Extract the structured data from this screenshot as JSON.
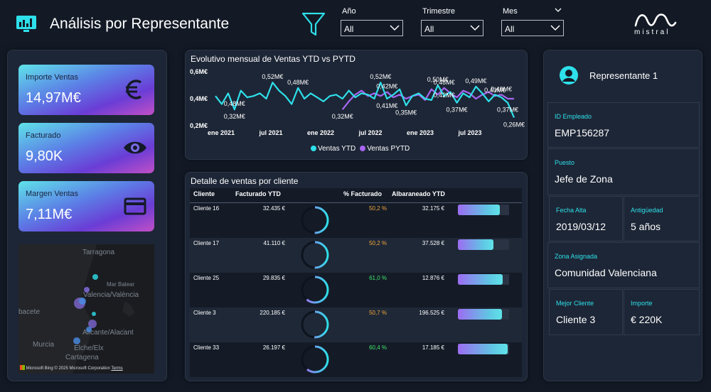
{
  "header": {
    "title": "Análisis por Representante",
    "brand": "mistral",
    "filters": [
      {
        "label": "Año",
        "value": "All"
      },
      {
        "label": "Trimestre",
        "value": "All"
      },
      {
        "label": "Mes",
        "value": "All"
      }
    ]
  },
  "kpis": [
    {
      "label": "Importe Ventas",
      "value": "14,97M€",
      "icon": "euro-icon"
    },
    {
      "label": "Facturado",
      "value": "9,80K",
      "icon": "eye-icon"
    },
    {
      "label": "Margen Ventas",
      "value": "7,11M€",
      "icon": "credit-card-icon"
    }
  ],
  "map": {
    "places": [
      "Tarragona",
      "Mar Balear",
      "Valencia/València",
      "bacete",
      "Alicante/Alacant",
      "Murcia",
      "Elche/Elx",
      "Cartagena"
    ],
    "copyright": "© 2025 Microsoft Corporation",
    "provider": "Microsoft Bing",
    "terms": "Terms"
  },
  "line_chart_title": "Evolutivo mensual de Ventas YTD vs PYTD",
  "chart_data": {
    "type": "line",
    "title": "Evolutivo mensual de Ventas YTD vs PYTD",
    "x_ticks": [
      "ene 2021",
      "jul 2021",
      "ene 2022",
      "jul 2022",
      "ene 2023",
      "jul 2023"
    ],
    "y_ticks": [
      "0,6M€",
      "0,4M€",
      "0,2M€"
    ],
    "ylim": [
      0.2,
      0.6
    ],
    "series": [
      {
        "name": "Ventas YTD",
        "color": "#2ee0ea",
        "values": [
          0.42,
          0.36,
          0.44,
          0.32,
          0.46,
          0.41,
          0.42,
          0.44,
          0.4,
          0.52,
          0.46,
          0.42,
          0.36,
          0.48,
          0.4,
          0.44,
          0.41,
          0.38,
          0.42,
          0.43,
          0.4,
          0.46,
          0.41,
          0.44,
          0.43,
          0.4,
          0.52,
          0.4,
          0.43,
          0.47,
          0.35,
          0.42,
          0.44,
          0.4,
          0.39,
          0.5,
          0.42,
          0.45,
          0.37,
          0.44,
          0.41,
          0.49,
          0.44,
          0.38,
          0.43,
          0.41,
          0.37,
          0.26
        ]
      },
      {
        "name": "Ventas PYTD",
        "color": "#a866f2",
        "values": [
          null,
          null,
          null,
          null,
          null,
          null,
          null,
          null,
          null,
          null,
          null,
          null,
          null,
          null,
          null,
          null,
          null,
          null,
          null,
          null,
          0.32,
          0.38,
          0.43,
          0.46,
          0.42,
          0.44,
          0.42,
          0.45,
          0.41,
          0.43,
          0.4,
          0.42,
          0.43,
          0.39,
          0.47,
          0.43,
          0.48,
          0.44,
          0.41,
          0.46,
          0.44,
          0.4,
          0.43,
          0.45,
          0.42,
          0.43,
          0.4,
          0.4
        ]
      }
    ],
    "data_labels": [
      {
        "text": "0,48M€",
        "series": 0,
        "index": 3,
        "pos": "above"
      },
      {
        "text": "0,32M€",
        "series": 0,
        "index": 3,
        "pos": "below"
      },
      {
        "text": "0,52M€",
        "series": 0,
        "index": 9,
        "pos": "above"
      },
      {
        "text": "0,48M€",
        "series": 0,
        "index": 13,
        "pos": "above"
      },
      {
        "text": "0,32M€",
        "series": 1,
        "index": 20,
        "pos": "below"
      },
      {
        "text": "0,52M€",
        "series": 0,
        "index": 26,
        "pos": "above"
      },
      {
        "text": "0,42M€",
        "series": 1,
        "index": 27,
        "pos": "above"
      },
      {
        "text": "0,41M€",
        "series": 0,
        "index": 27,
        "pos": "below"
      },
      {
        "text": "0,50M€",
        "series": 0,
        "index": 35,
        "pos": "above"
      },
      {
        "text": "0,48M€",
        "series": 1,
        "index": 36,
        "pos": "above"
      },
      {
        "text": "0,42M€",
        "series": 1,
        "index": 36,
        "pos": "below"
      },
      {
        "text": "0,35M€",
        "series": 0,
        "index": 30,
        "pos": "below"
      },
      {
        "text": "0,37M€",
        "series": 0,
        "index": 38,
        "pos": "below"
      },
      {
        "text": "0,49M€",
        "series": 0,
        "index": 41,
        "pos": "above"
      },
      {
        "text": "0,43M€",
        "series": 1,
        "index": 44,
        "pos": "above"
      },
      {
        "text": "0,40M€",
        "series": 1,
        "index": 45,
        "pos": "above"
      },
      {
        "text": "0,37M€",
        "series": 0,
        "index": 46,
        "pos": "below"
      },
      {
        "text": "0,26M€",
        "series": 0,
        "index": 47,
        "pos": "below"
      }
    ]
  },
  "table": {
    "title": "Detalle de ventas por cliente",
    "columns": [
      "Cliente",
      "Facturado YTD",
      "% Facturado",
      "Albaraneado YTD"
    ],
    "rows": [
      {
        "cliente": "Cliente 16",
        "facturado": "32.435 €",
        "pct": "50,2 %",
        "pct_value": 0.502,
        "pct_color": "#f0a63a",
        "albaraneado": "32.175 €",
        "bar": 0.82
      },
      {
        "cliente": "Cliente 17",
        "facturado": "41.110 €",
        "pct": "50,2 %",
        "pct_value": 0.502,
        "pct_color": "#f0a63a",
        "albaraneado": "37.528 €",
        "bar": 0.7
      },
      {
        "cliente": "Cliente 25",
        "facturado": "29.835 €",
        "pct": "61,0 %",
        "pct_value": 0.61,
        "pct_color": "#3fe36a",
        "albaraneado": "12.876 €",
        "bar": 0.88
      },
      {
        "cliente": "Cliente 3",
        "facturado": "220.185 €",
        "pct": "50,7 %",
        "pct_value": 0.507,
        "pct_color": "#f0a63a",
        "albaraneado": "196.525 €",
        "bar": 0.86
      },
      {
        "cliente": "Cliente 33",
        "facturado": "26.197 €",
        "pct": "60,4 %",
        "pct_value": 0.604,
        "pct_color": "#3fe36a",
        "albaraneado": "17.185 €",
        "bar": 0.97
      }
    ]
  },
  "representative": {
    "name": "Representante 1",
    "fields": {
      "id_label": "ID Empleado",
      "id_value": "EMP156287",
      "puesto_label": "Puesto",
      "puesto_value": "Jefe de Zona",
      "alta_label": "Fecha Alta",
      "alta_value": "2019/03/12",
      "antig_label": "Antigüedad",
      "antig_value": "5 años",
      "zona_label": "Zona Asignada",
      "zona_value": "Comunidad Valenciana",
      "mejor_label": "Mejor Cliente",
      "mejor_value": "Cliente 3",
      "importe_label": "Importe",
      "importe_value": "€ 220K"
    }
  },
  "colors": {
    "accent": "#2ee0ea",
    "purple": "#a866f2",
    "background": "#131a26",
    "panel": "#1d2636"
  }
}
